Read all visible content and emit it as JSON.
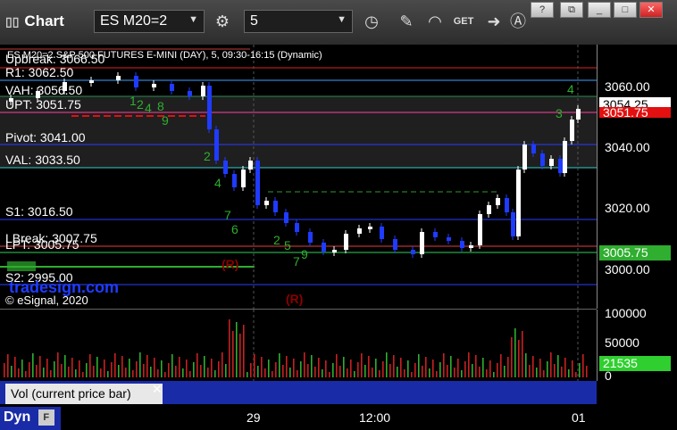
{
  "toolbar": {
    "title": "Chart",
    "symbol": "ES M20=2",
    "interval": "5"
  },
  "chart": {
    "header": "ES M20=2 S&P 500 FUTURES E-MINI (DAY), 5, 09:30-16:15 (Dynamic)",
    "copyright": "© eSignal, 2020",
    "levels": {
      "r1": "R1: 3062.50",
      "vah": "VAH: 3056.50",
      "upt": "UPT: 3051.75",
      "pivot": "Pivot: 3041.00",
      "val": "VAL: 3033.50",
      "s1": "S1: 3016.50",
      "lpt": "LPT: 3005.75",
      "s2": "S2: 2995.00"
    },
    "overlap_texts": {
      "upbreak": "Upbreak: 3066.50",
      "lbreak": "LBreak: 3007.75"
    },
    "r_markers": [
      "(R)",
      "(R)"
    ],
    "watermark": "tradesign.com"
  },
  "price_axis": {
    "ticks": [
      "3060.00",
      "3040.00",
      "3020.00",
      "3000.00"
    ],
    "last_price": "3054.25",
    "upt_tag": "3051.75",
    "lpt_tag": "3005.75"
  },
  "volume": {
    "ticks": [
      "100000",
      "50000",
      "0"
    ],
    "current": "21535",
    "label": "Vol (current price bar)"
  },
  "bottom": {
    "mode": "Dyn",
    "x_labels": [
      "29",
      "12:00",
      "01"
    ]
  },
  "colors": {
    "up_candle": "#ffffff",
    "down_candle": "#1f3bff",
    "green_tag": "#2fae2f",
    "red_tag": "#e21010"
  }
}
